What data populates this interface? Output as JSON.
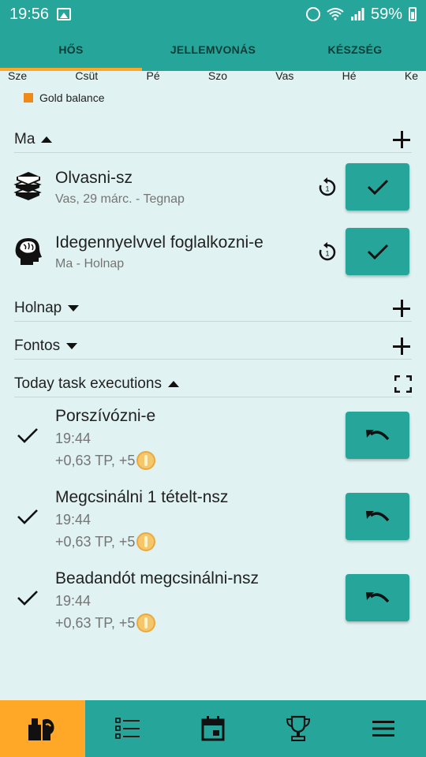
{
  "status_bar": {
    "time": "19:56",
    "battery": "59%",
    "icons": [
      "gallery-icon",
      "alarm-icon",
      "wifi-icon",
      "signal-icon",
      "battery-icon"
    ]
  },
  "tabs": [
    {
      "label": "HŐS",
      "active": true
    },
    {
      "label": "JELLEMVONÁS",
      "active": false
    },
    {
      "label": "KÉSZSÉG",
      "active": false
    }
  ],
  "days": [
    "Sze",
    "Csüt",
    "Pé",
    "Szo",
    "Vas",
    "Hé",
    "Ke"
  ],
  "legend": {
    "label": "Gold balance",
    "color": "#f0891a"
  },
  "sections": {
    "today": {
      "label": "Ma"
    },
    "tomorrow": {
      "label": "Holnap"
    },
    "important": {
      "label": "Fontos"
    },
    "executions": {
      "label": "Today task executions"
    }
  },
  "today_tasks": [
    {
      "title": "Olvasni-sz",
      "subtitle": "Vas, 29 márc. - Tegnap",
      "icon": "books-icon"
    },
    {
      "title": "Idegennyelvvel foglalkozni-e",
      "subtitle": "Ma - Holnap",
      "icon": "brain-head-icon"
    }
  ],
  "executions": [
    {
      "title": "Porszívózni-e",
      "time": "19:44",
      "reward": "+0,63 TP, +5"
    },
    {
      "title": "Megcsinálni 1 tételt-nsz",
      "time": "19:44",
      "reward": "+0,63 TP, +5"
    },
    {
      "title": "Beadandót megcsinálni-nsz",
      "time": "19:44",
      "reward": "+0,63 TP, +5"
    }
  ],
  "bottom_nav": [
    {
      "icon": "hero-icon",
      "active": true
    },
    {
      "icon": "task-list-icon",
      "active": false
    },
    {
      "icon": "calendar-icon",
      "active": false
    },
    {
      "icon": "trophy-icon",
      "active": false
    },
    {
      "icon": "menu-icon",
      "active": false
    }
  ],
  "colors": {
    "primary": "#26a69a",
    "accent": "#ffa726",
    "background": "#e0f2f1"
  }
}
